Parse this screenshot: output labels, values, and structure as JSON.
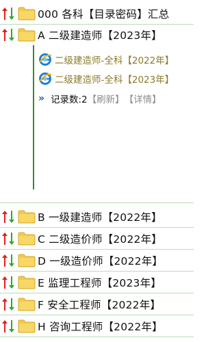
{
  "rows_top": [
    {
      "label": "000 各科【目录密码】汇总"
    },
    {
      "label": "A 二级建造师【2023年】"
    }
  ],
  "expanded": {
    "sub_items": [
      {
        "label": "二级建造师-全科【2022年】",
        "icon": "ie-icon"
      },
      {
        "label": "二级建造师-全科【2023年】",
        "icon": "ie-icon"
      }
    ],
    "record_count_label": "记录数:2",
    "refresh_link": "【刷新】",
    "detail_link": "【详情】"
  },
  "rows_bottom": [
    {
      "label": "B 一级建造师【2022年】"
    },
    {
      "label": "C 二级造价师【2022年】"
    },
    {
      "label": "D 一级造价师【2022年】"
    },
    {
      "label": "E 监理工程师【2023年】"
    },
    {
      "label": "F 安全工程师【2022年】"
    },
    {
      "label": "H 咨询工程师【2022年】"
    }
  ],
  "colors": {
    "sort_up": "#e0201a",
    "sort_down": "#2ea82e",
    "folder": "#f2c94c",
    "tree_line": "#2e8b2e",
    "link": "#8a7a2a",
    "muted_link": "#8c8c8c",
    "divider": "#b9dcb9"
  }
}
